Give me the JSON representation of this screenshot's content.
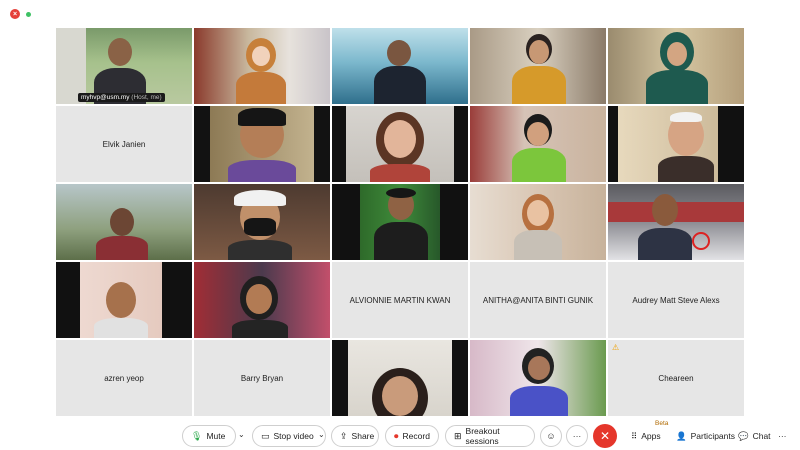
{
  "window": {
    "close_glyph": "×"
  },
  "tiles": [
    {
      "name": "myhvp@usm.my",
      "sub": " (Host, me)"
    },
    {
      "name": "Elvik Janien"
    },
    {
      "name": "ALVIONNIE MARTIN KWAN"
    },
    {
      "name": "ANITHA@ANITA BINTI GUNIK"
    },
    {
      "name": "Audrey Matt Steve Alexs"
    },
    {
      "name": "azren yeop"
    },
    {
      "name": "Barry Bryan"
    },
    {
      "name": "Cheareen"
    }
  ],
  "toolbar": {
    "mute": "Mute",
    "stop_video": "Stop video",
    "share": "Share",
    "record": "Record",
    "breakout": "Breakout sessions",
    "apps": "Apps",
    "apps_badge": "Beta",
    "participants": "Participants",
    "chat": "Chat",
    "more": "···",
    "end": "✕"
  },
  "colors": {
    "accent": "#1ea7fd",
    "end": "#e5362b",
    "mic": "#2aa84a"
  }
}
